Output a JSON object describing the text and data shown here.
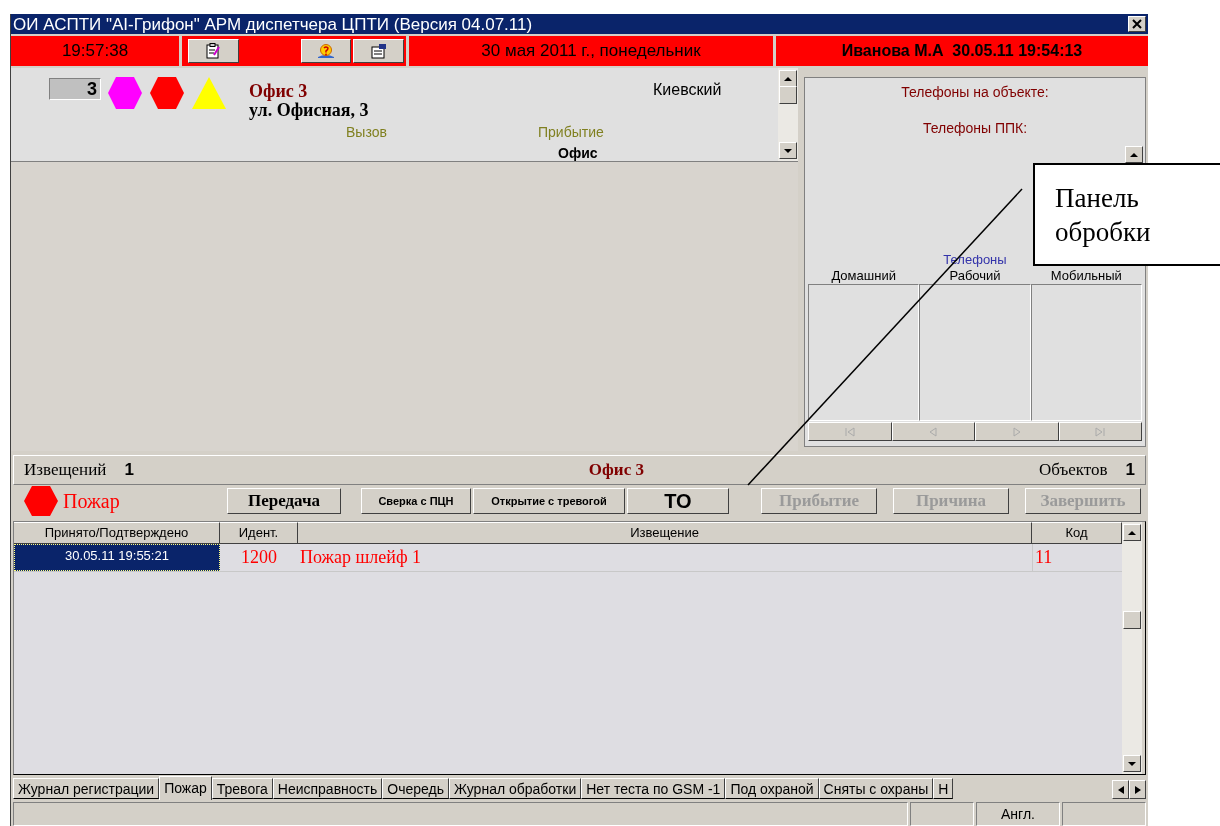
{
  "window": {
    "title": "ОИ АСПТИ \"АI-Грифон\" АРМ диспетчера ЦПТИ (Версия 04.07.11)"
  },
  "header": {
    "clock": "19:57:38",
    "date": "30 мая 2011 г., понедельник",
    "operator": "Иванова М.А  30.05.11 19:54:13"
  },
  "object": {
    "number": "3",
    "name": "Офис 3",
    "address": "ул. Офисная, 3",
    "district": "Киевский",
    "call_label": "Вызов",
    "arrival_label": "Прибытие",
    "arrival_value": "Офис"
  },
  "phones": {
    "on_object": "Телефоны на объекте:",
    "ppk": "Телефоны ППК:",
    "group": "Телефоны",
    "columns": [
      "Домашний",
      "Рабочий",
      "Мобильный"
    ]
  },
  "summary": {
    "notices_label": "Извещений",
    "notices_count": "1",
    "object": "Офис 3",
    "objects_label": "Объектов",
    "objects_count": "1"
  },
  "event": {
    "type": "Пожар"
  },
  "buttons": [
    {
      "label": "Передача",
      "kind": "serif",
      "disabled": false
    },
    {
      "label": "Сверка с ПЦН",
      "kind": "small",
      "disabled": false
    },
    {
      "label": "Открытие с тревогой",
      "kind": "small",
      "disabled": false
    },
    {
      "label": "ТО",
      "kind": "large",
      "disabled": false
    },
    {
      "label": "Прибытие",
      "kind": "serif",
      "disabled": true
    },
    {
      "label": "Причина",
      "kind": "serif",
      "disabled": true
    },
    {
      "label": "Завершить",
      "kind": "serif",
      "disabled": true
    }
  ],
  "table": {
    "columns": [
      "Принято/Подтверждено",
      "Идент.",
      "Извещение",
      "Код"
    ],
    "rows": [
      {
        "cells": [
          "30.05.11 19:55:21",
          "1200",
          "Пожар шлейф 1",
          "11"
        ],
        "selected": true
      }
    ]
  },
  "tabs": [
    {
      "label": "Журнал регистрации",
      "selected": false
    },
    {
      "label": "Пожар",
      "selected": true
    },
    {
      "label": "Тревога",
      "selected": false
    },
    {
      "label": "Неисправность",
      "selected": false
    },
    {
      "label": "Очередь",
      "selected": false
    },
    {
      "label": "Журнал обработки",
      "selected": false
    },
    {
      "label": "Нет теста по GSM -1",
      "selected": false
    },
    {
      "label": "Под охраной",
      "selected": false
    },
    {
      "label": "Сняты с охраны",
      "selected": false
    },
    {
      "label": "Н",
      "selected": false
    }
  ],
  "status_bar": {
    "language": "Англ."
  },
  "callout": {
    "text": "Панель обробки"
  }
}
